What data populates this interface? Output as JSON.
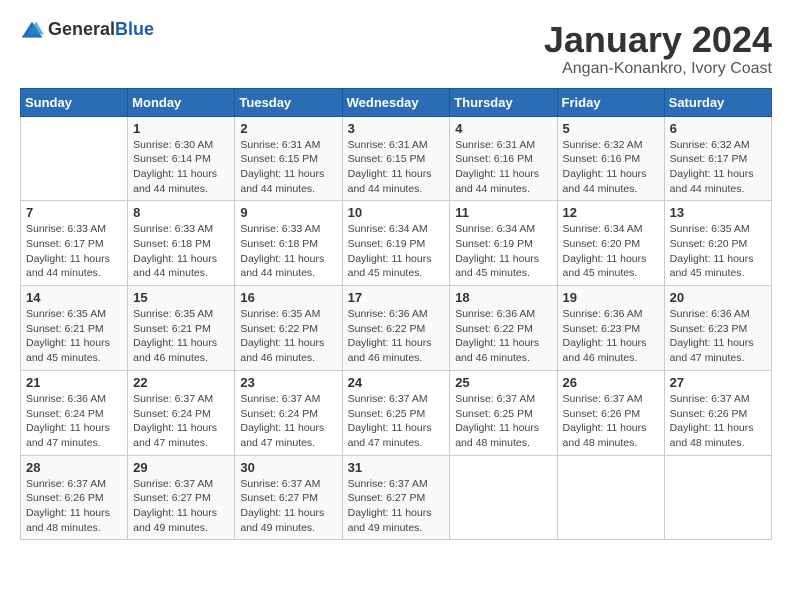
{
  "logo": {
    "text_general": "General",
    "text_blue": "Blue"
  },
  "title": "January 2024",
  "location": "Angan-Konankro, Ivory Coast",
  "days_of_week": [
    "Sunday",
    "Monday",
    "Tuesday",
    "Wednesday",
    "Thursday",
    "Friday",
    "Saturday"
  ],
  "weeks": [
    [
      {
        "day": "",
        "info": ""
      },
      {
        "day": "1",
        "info": "Sunrise: 6:30 AM\nSunset: 6:14 PM\nDaylight: 11 hours and 44 minutes."
      },
      {
        "day": "2",
        "info": "Sunrise: 6:31 AM\nSunset: 6:15 PM\nDaylight: 11 hours and 44 minutes."
      },
      {
        "day": "3",
        "info": "Sunrise: 6:31 AM\nSunset: 6:15 PM\nDaylight: 11 hours and 44 minutes."
      },
      {
        "day": "4",
        "info": "Sunrise: 6:31 AM\nSunset: 6:16 PM\nDaylight: 11 hours and 44 minutes."
      },
      {
        "day": "5",
        "info": "Sunrise: 6:32 AM\nSunset: 6:16 PM\nDaylight: 11 hours and 44 minutes."
      },
      {
        "day": "6",
        "info": "Sunrise: 6:32 AM\nSunset: 6:17 PM\nDaylight: 11 hours and 44 minutes."
      }
    ],
    [
      {
        "day": "7",
        "info": "Sunrise: 6:33 AM\nSunset: 6:17 PM\nDaylight: 11 hours and 44 minutes."
      },
      {
        "day": "8",
        "info": "Sunrise: 6:33 AM\nSunset: 6:18 PM\nDaylight: 11 hours and 44 minutes."
      },
      {
        "day": "9",
        "info": "Sunrise: 6:33 AM\nSunset: 6:18 PM\nDaylight: 11 hours and 44 minutes."
      },
      {
        "day": "10",
        "info": "Sunrise: 6:34 AM\nSunset: 6:19 PM\nDaylight: 11 hours and 45 minutes."
      },
      {
        "day": "11",
        "info": "Sunrise: 6:34 AM\nSunset: 6:19 PM\nDaylight: 11 hours and 45 minutes."
      },
      {
        "day": "12",
        "info": "Sunrise: 6:34 AM\nSunset: 6:20 PM\nDaylight: 11 hours and 45 minutes."
      },
      {
        "day": "13",
        "info": "Sunrise: 6:35 AM\nSunset: 6:20 PM\nDaylight: 11 hours and 45 minutes."
      }
    ],
    [
      {
        "day": "14",
        "info": "Sunrise: 6:35 AM\nSunset: 6:21 PM\nDaylight: 11 hours and 45 minutes."
      },
      {
        "day": "15",
        "info": "Sunrise: 6:35 AM\nSunset: 6:21 PM\nDaylight: 11 hours and 46 minutes."
      },
      {
        "day": "16",
        "info": "Sunrise: 6:35 AM\nSunset: 6:22 PM\nDaylight: 11 hours and 46 minutes."
      },
      {
        "day": "17",
        "info": "Sunrise: 6:36 AM\nSunset: 6:22 PM\nDaylight: 11 hours and 46 minutes."
      },
      {
        "day": "18",
        "info": "Sunrise: 6:36 AM\nSunset: 6:22 PM\nDaylight: 11 hours and 46 minutes."
      },
      {
        "day": "19",
        "info": "Sunrise: 6:36 AM\nSunset: 6:23 PM\nDaylight: 11 hours and 46 minutes."
      },
      {
        "day": "20",
        "info": "Sunrise: 6:36 AM\nSunset: 6:23 PM\nDaylight: 11 hours and 47 minutes."
      }
    ],
    [
      {
        "day": "21",
        "info": "Sunrise: 6:36 AM\nSunset: 6:24 PM\nDaylight: 11 hours and 47 minutes."
      },
      {
        "day": "22",
        "info": "Sunrise: 6:37 AM\nSunset: 6:24 PM\nDaylight: 11 hours and 47 minutes."
      },
      {
        "day": "23",
        "info": "Sunrise: 6:37 AM\nSunset: 6:24 PM\nDaylight: 11 hours and 47 minutes."
      },
      {
        "day": "24",
        "info": "Sunrise: 6:37 AM\nSunset: 6:25 PM\nDaylight: 11 hours and 47 minutes."
      },
      {
        "day": "25",
        "info": "Sunrise: 6:37 AM\nSunset: 6:25 PM\nDaylight: 11 hours and 48 minutes."
      },
      {
        "day": "26",
        "info": "Sunrise: 6:37 AM\nSunset: 6:26 PM\nDaylight: 11 hours and 48 minutes."
      },
      {
        "day": "27",
        "info": "Sunrise: 6:37 AM\nSunset: 6:26 PM\nDaylight: 11 hours and 48 minutes."
      }
    ],
    [
      {
        "day": "28",
        "info": "Sunrise: 6:37 AM\nSunset: 6:26 PM\nDaylight: 11 hours and 48 minutes."
      },
      {
        "day": "29",
        "info": "Sunrise: 6:37 AM\nSunset: 6:27 PM\nDaylight: 11 hours and 49 minutes."
      },
      {
        "day": "30",
        "info": "Sunrise: 6:37 AM\nSunset: 6:27 PM\nDaylight: 11 hours and 49 minutes."
      },
      {
        "day": "31",
        "info": "Sunrise: 6:37 AM\nSunset: 6:27 PM\nDaylight: 11 hours and 49 minutes."
      },
      {
        "day": "",
        "info": ""
      },
      {
        "day": "",
        "info": ""
      },
      {
        "day": "",
        "info": ""
      }
    ]
  ]
}
